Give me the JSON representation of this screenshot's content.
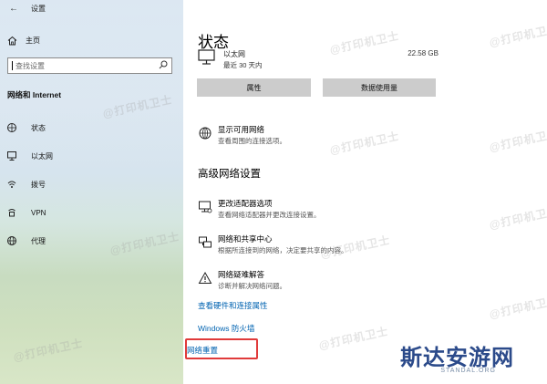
{
  "window": {
    "title": "设置"
  },
  "sidebar": {
    "home_label": "主页",
    "search_placeholder": "查找设置",
    "section_title": "网络和 Internet",
    "items": [
      {
        "label": "状态",
        "icon": "status-icon"
      },
      {
        "label": "以太网",
        "icon": "ethernet-icon"
      },
      {
        "label": "拨号",
        "icon": "dialup-icon"
      },
      {
        "label": "VPN",
        "icon": "vpn-icon"
      },
      {
        "label": "代理",
        "icon": "globe-icon"
      }
    ]
  },
  "main": {
    "title": "状态",
    "ethernet": {
      "name": "以太网",
      "sub": "最近 30 天内",
      "size": "22.58 GB"
    },
    "buttons": {
      "properties": "属性",
      "data_usage": "数据使用量"
    },
    "show_networks": {
      "title": "显示可用网络",
      "desc": "查看周围的连接选项。"
    },
    "advanced_heading": "高级网络设置",
    "advanced_items": [
      {
        "title": "更改适配器选项",
        "desc": "查看网络适配器并更改连接设置。"
      },
      {
        "title": "网络和共享中心",
        "desc": "根据所连接到的网络，决定要共享的内容。"
      },
      {
        "title": "网络疑难解答",
        "desc": "诊断并解决网络问题。"
      }
    ],
    "links": {
      "hardware": "查看硬件和连接属性",
      "firewall": "Windows 防火墙",
      "reset": "网络重置"
    }
  },
  "watermarks": {
    "text": "@打印机卫士",
    "logo": "斯达安游网",
    "logo_sub": "STANDAL.ORG"
  },
  "colors": {
    "accent": "#0063b1",
    "highlight": "#e03a3a",
    "button": "#cccccc"
  }
}
